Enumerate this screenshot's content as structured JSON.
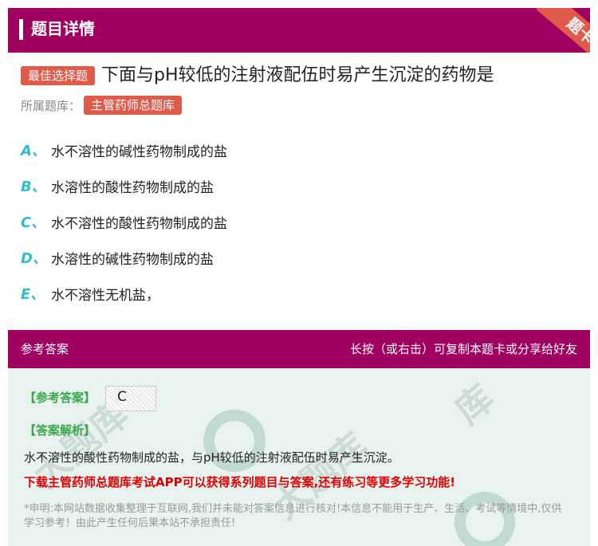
{
  "header": {
    "title": "题目详情",
    "corner_tag": "题卡"
  },
  "question": {
    "type_tag": "最佳选择题",
    "text": "下面与pH较低的注射液配伍时易产生沉淀的药物是",
    "bank_label": "所属题库：",
    "bank_name": "主管药师总题库"
  },
  "options": [
    {
      "letter": "A、",
      "text": "水不溶性的碱性药物制成的盐"
    },
    {
      "letter": "B、",
      "text": "水溶性的酸性药物制成的盐"
    },
    {
      "letter": "C、",
      "text": "水不溶性的酸性药物制成的盐"
    },
    {
      "letter": "D、",
      "text": "水溶性的碱性药物制成的盐"
    },
    {
      "letter": "E、",
      "text": "水不溶性无机盐，"
    }
  ],
  "answer_section": {
    "title": "参考答案",
    "hint": "长按（或右击）可复制本题卡或分享给好友",
    "answer_label": "【参考答案】",
    "answer_value": "C",
    "analysis_label": "【答案解析】",
    "analysis_text": "水不溶性的酸性药物制成的盐，与pH较低的注射液配伍时易产生沉淀。",
    "promo_text": "下载主管药师总题库考试APP可以获得系列题目与答案,还有练习等更多学习功能!",
    "disclaimer": "*申明:本网站数据收集整理于互联网,我们并未能对答案信息进行核对!本信息不能用于生产、生活、考试等情境中,仅供学习参考！由此产生任何后果本站不承担责任!"
  },
  "colors": {
    "header_bg": "#a0005f",
    "tag_bg": "#e05a4a",
    "option_letter": "#2fbfc7",
    "answer_bg": "#e8f3ef",
    "label_green": "#3aa84a",
    "promo_red": "#e00000"
  }
}
